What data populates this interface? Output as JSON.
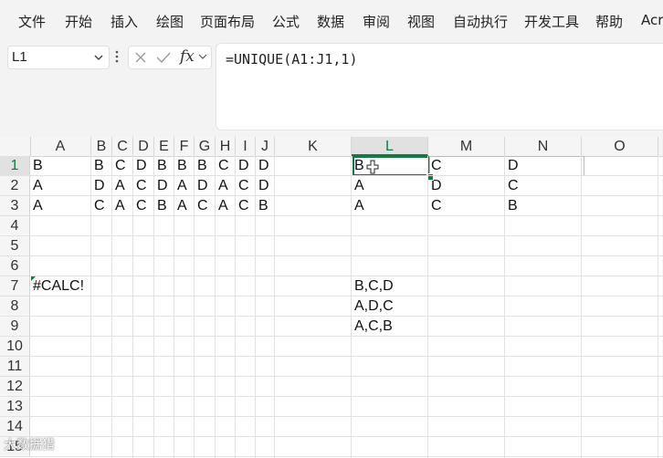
{
  "menu": [
    "文件",
    "开始",
    "插入",
    "绘图",
    "页面布局",
    "公式",
    "数据",
    "审阅",
    "视图",
    "自动执行",
    "开发工具",
    "帮助",
    "Acr"
  ],
  "name_box": "L1",
  "fx_label": "fx",
  "formula": "=UNIQUE(A1:J1,1)",
  "columns": [
    "A",
    "B",
    "C",
    "D",
    "E",
    "F",
    "G",
    "H",
    "I",
    "J",
    "K",
    "L",
    "M",
    "N",
    "O"
  ],
  "active_column": "L",
  "rows": [
    "1",
    "2",
    "3",
    "4",
    "5",
    "6",
    "7",
    "8",
    "9",
    "10",
    "11",
    "12",
    "13",
    "14",
    "15"
  ],
  "active_row": "1",
  "cells": {
    "A1": "B",
    "B1": "B",
    "C1": "C",
    "D1": "D",
    "E1": "B",
    "F1": "B",
    "G1": "B",
    "H1": "C",
    "I1": "D",
    "J1": "D",
    "L1": "B",
    "M1": "C",
    "N1": "D",
    "A2": "A",
    "B2": "D",
    "C2": "A",
    "D2": "C",
    "E2": "D",
    "F2": "A",
    "G2": "D",
    "H2": "A",
    "I2": "C",
    "J2": "D",
    "L2": "A",
    "M2": "D",
    "N2": "C",
    "A3": "A",
    "B3": "C",
    "C3": "A",
    "D3": "C",
    "E3": "B",
    "F3": "A",
    "G3": "C",
    "H3": "A",
    "I3": "C",
    "J3": "B",
    "L3": "A",
    "M3": "C",
    "N3": "B",
    "A7": "#CALC!",
    "L7": "B,C,D",
    "L8": "A,D,C",
    "L9": "A,C,B"
  },
  "watermark": "大数据猎"
}
